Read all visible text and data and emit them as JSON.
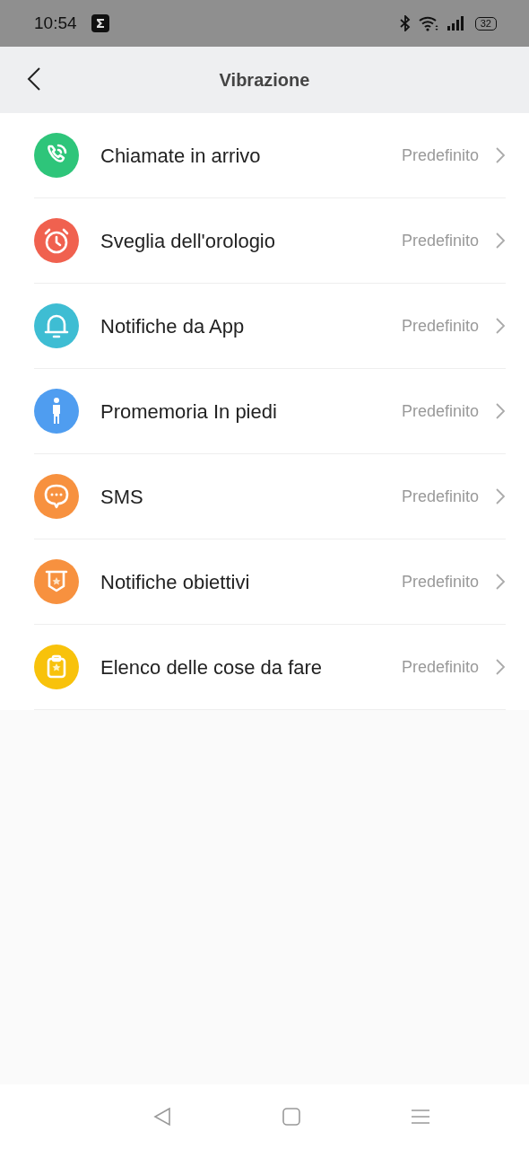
{
  "status_bar": {
    "time": "10:54",
    "battery": "32"
  },
  "header": {
    "title": "Vibrazione"
  },
  "items": [
    {
      "kind": "call",
      "color": "#2ec57a",
      "label": "Chiamate in arrivo",
      "value": "Predefinito"
    },
    {
      "kind": "alarm",
      "color": "#f0614f",
      "label": "Sveglia dell'orologio",
      "value": "Predefinito"
    },
    {
      "kind": "bell",
      "color": "#3ebdd3",
      "label": "Notifiche da App",
      "value": "Predefinito"
    },
    {
      "kind": "person",
      "color": "#4f9df0",
      "label": "Promemoria In piedi",
      "value": "Predefinito"
    },
    {
      "kind": "chat",
      "color": "#f7913f",
      "label": "SMS",
      "value": "Predefinito"
    },
    {
      "kind": "badge",
      "color": "#f7913f",
      "label": "Notifiche obiettivi",
      "value": "Predefinito"
    },
    {
      "kind": "clipboard",
      "color": "#f8c20b",
      "label": "Elenco delle cose da fare",
      "value": "Predefinito"
    }
  ]
}
